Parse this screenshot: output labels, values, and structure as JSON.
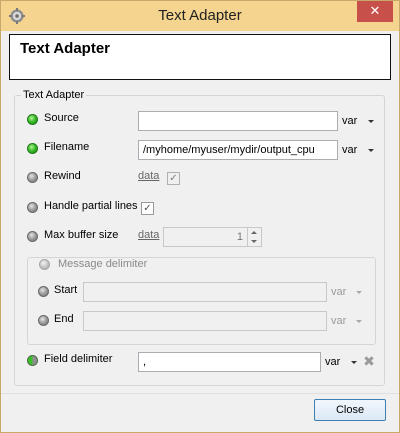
{
  "window": {
    "title": "Text Adapter",
    "close_glyph": "✕"
  },
  "header": {
    "title": "Text Adapter"
  },
  "group": {
    "legend": "Text Adapter",
    "source": {
      "label": "Source",
      "value": "",
      "type": "var"
    },
    "filename": {
      "label": "Filename",
      "value": "/myhome/myuser/mydir/output_cpu",
      "type": "var"
    },
    "rewind": {
      "label": "Rewind",
      "type": "data",
      "checked_glyph": "✓"
    },
    "handle_partial": {
      "label": "Handle partial lines",
      "checked_glyph": "✓"
    },
    "max_buffer": {
      "label": "Max buffer size",
      "type": "data",
      "value": "1"
    },
    "message_delimiter": {
      "legend": "Message delimiter",
      "start": {
        "label": "Start",
        "value": "",
        "type": "var"
      },
      "end": {
        "label": "End",
        "value": "",
        "type": "var"
      }
    },
    "field_delimiter": {
      "label": "Field delimiter",
      "value": ",",
      "type": "var",
      "delete_glyph": "✖"
    }
  },
  "footer": {
    "close_label": "Close"
  },
  "colors": {
    "titlebar": "#f4d48f",
    "close_button": "#c7504a",
    "status_active": "#3bbf2a",
    "status_inactive": "#9a9a9a"
  },
  "icons": {
    "app": "gear-icon",
    "status": "status-led-icon",
    "dropdown": "caret-down-icon",
    "delete": "delete-icon"
  }
}
